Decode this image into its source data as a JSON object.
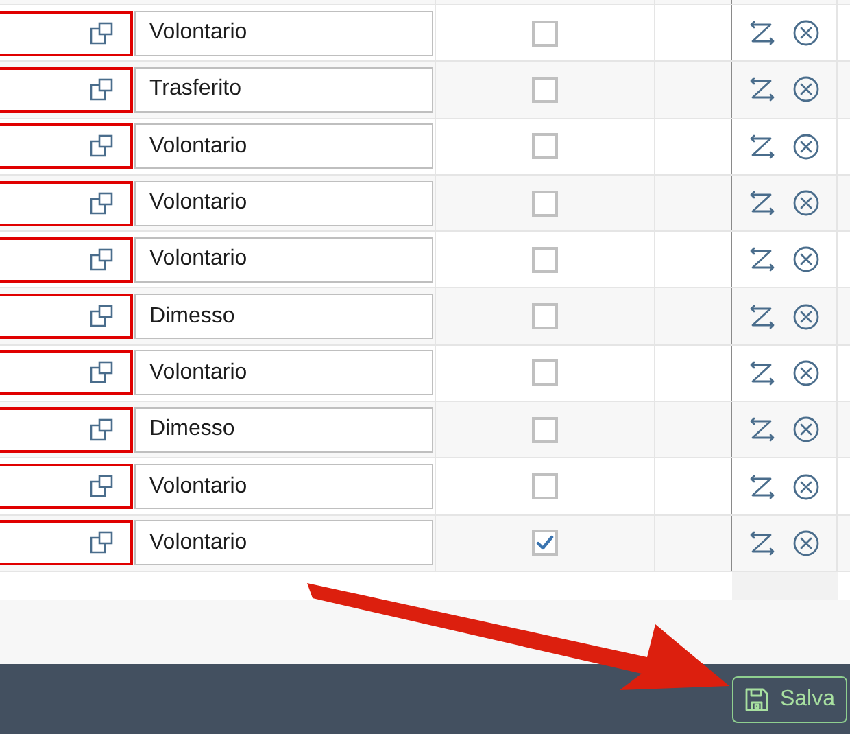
{
  "rows": [
    {
      "invalid": true,
      "reason": "Volontario",
      "checked": false
    },
    {
      "invalid": true,
      "reason": "Trasferito",
      "checked": false
    },
    {
      "invalid": true,
      "reason": "Volontario",
      "checked": false
    },
    {
      "invalid": true,
      "reason": "Volontario",
      "checked": false
    },
    {
      "invalid": true,
      "reason": "Volontario",
      "checked": false
    },
    {
      "invalid": true,
      "reason": "Dimesso",
      "checked": false
    },
    {
      "invalid": true,
      "reason": "Volontario",
      "checked": false
    },
    {
      "invalid": true,
      "reason": "Dimesso",
      "checked": false
    },
    {
      "invalid": true,
      "reason": "Volontario",
      "checked": false
    },
    {
      "invalid": true,
      "reason": "Volontario",
      "checked": true
    }
  ],
  "footer": {
    "save_button": "Salva"
  }
}
